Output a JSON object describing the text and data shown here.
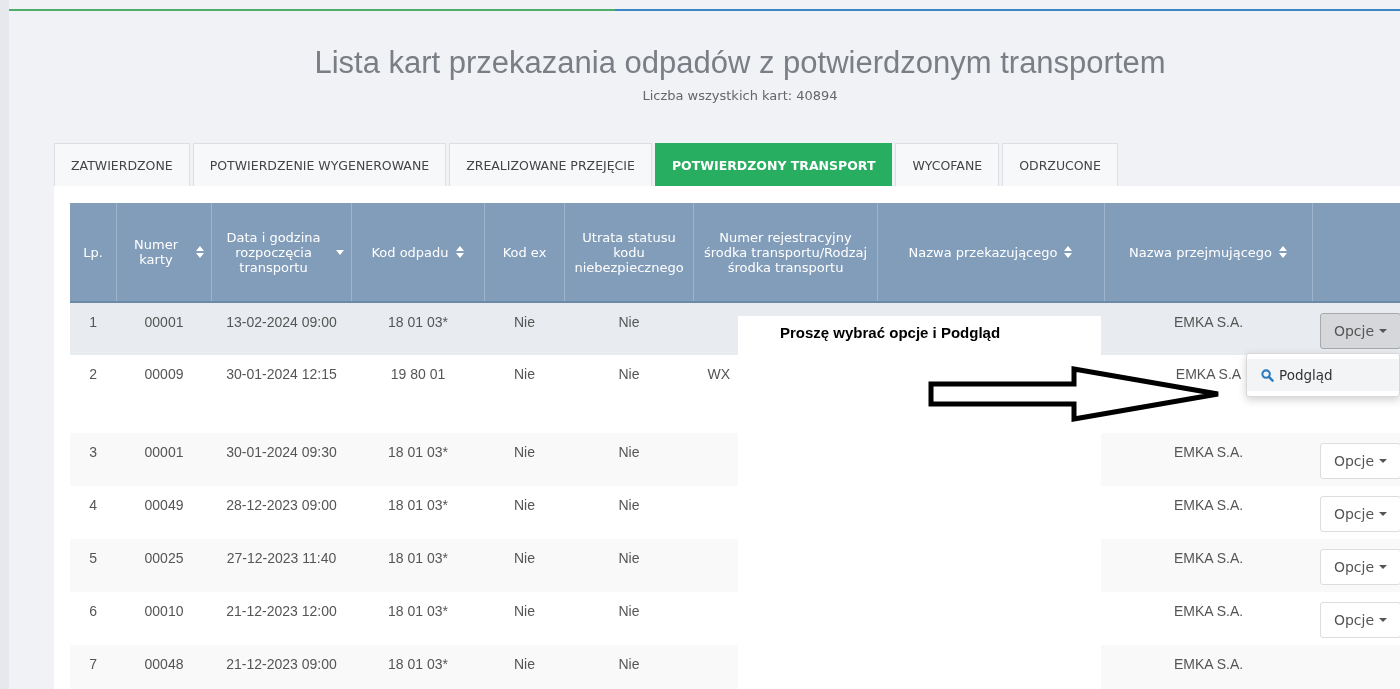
{
  "title": "Lista kart przekazania odpadów z potwierdzonym transportem",
  "subtitle": "Liczba wszystkich kart: 40894",
  "tabs": [
    {
      "label": "ZATWIERDZONE",
      "selected": false
    },
    {
      "label": "POTWIERDZENIE WYGENEROWANE",
      "selected": false
    },
    {
      "label": "ZREALIZOWANE PRZEJĘCIE",
      "selected": false
    },
    {
      "label": "POTWIERDZONY TRANSPORT",
      "selected": true
    },
    {
      "label": "WYCOFANE",
      "selected": false
    },
    {
      "label": "ODRZUCONE",
      "selected": false
    }
  ],
  "table": {
    "columns": [
      {
        "label": "Lp.",
        "sortable": false
      },
      {
        "label": "Numer karty",
        "sortable": true,
        "sorted_desc": false
      },
      {
        "label": "Data i godzina rozpoczęcia transportu",
        "sortable": true,
        "sorted_desc": true
      },
      {
        "label": "Kod odpadu",
        "sortable": true,
        "sorted_desc": false
      },
      {
        "label": "Kod ex",
        "sortable": false
      },
      {
        "label": "Utrata statusu kodu niebezpiecznego",
        "sortable": false
      },
      {
        "label": "Numer rejestracyjny środka transportu/Rodzaj środka transportu",
        "sortable": false
      },
      {
        "label": "Nazwa przekazującego",
        "sortable": true,
        "sorted_desc": false
      },
      {
        "label": "Nazwa przejmującego",
        "sortable": true,
        "sorted_desc": false
      },
      {
        "sortable": false
      }
    ],
    "rows": [
      {
        "cells": [
          "1",
          "00001",
          "13-02-2024 09:00",
          "18 01 03*",
          "Nie",
          "Nie",
          "",
          "",
          "EMKA S.A."
        ],
        "highlighted": true,
        "button": {
          "label": "Opcje",
          "active": true
        },
        "tall": false
      },
      {
        "cells": [
          "2",
          "00009",
          "30-01-2024 12:15",
          "19 80 01",
          "Nie",
          "Nie",
          "WX",
          "",
          "EMKA S.A"
        ],
        "highlighted": false,
        "tall": true
      },
      {
        "cells": [
          "3",
          "00001",
          "30-01-2024 09:30",
          "18 01 03*",
          "Nie",
          "Nie",
          "",
          "",
          "EMKA S.A."
        ],
        "highlighted": false,
        "button": {
          "label": "Opcje",
          "active": false
        },
        "tall": false
      },
      {
        "cells": [
          "4",
          "00049",
          "28-12-2023 09:00",
          "18 01 03*",
          "Nie",
          "Nie",
          "",
          "",
          "EMKA S.A."
        ],
        "highlighted": false,
        "button": {
          "label": "Opcje",
          "active": false
        },
        "tall": false
      },
      {
        "cells": [
          "5",
          "00025",
          "27-12-2023 11:40",
          "18 01 03*",
          "Nie",
          "Nie",
          "",
          "",
          "EMKA S.A."
        ],
        "highlighted": false,
        "button": {
          "label": "Opcje",
          "active": false
        },
        "tall": false
      },
      {
        "cells": [
          "6",
          "00010",
          "21-12-2023 12:00",
          "18 01 03*",
          "Nie",
          "Nie",
          "",
          "",
          "EMKA S.A."
        ],
        "highlighted": false,
        "button": {
          "label": "Opcje",
          "active": false
        },
        "tall": false
      },
      {
        "cells": [
          "7",
          "00048",
          "21-12-2023 09:00",
          "18 01 03*",
          "Nie",
          "Nie",
          "",
          "",
          "EMKA S.A."
        ],
        "highlighted": false,
        "tall": false
      }
    ]
  },
  "dropdown": {
    "items": [
      "Podgląd"
    ]
  },
  "annotation": {
    "text": "Proszę wybrać opcje i Podgląd"
  }
}
